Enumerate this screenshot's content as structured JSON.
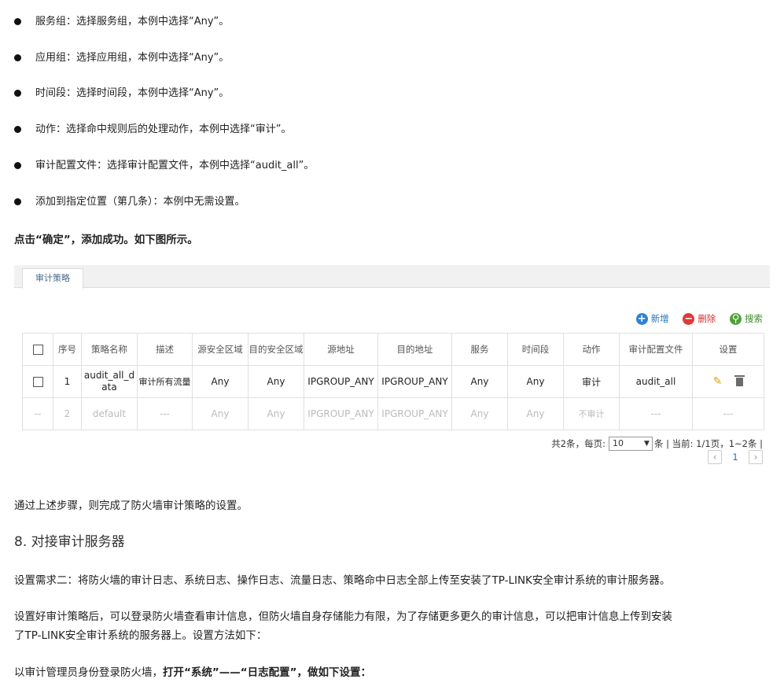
{
  "bullets": [
    "服务组：选择服务组，本例中选择“Any”。",
    "应用组：选择应用组，本例中选择“Any”。",
    "时间段：选择时间段，本例中选择“Any”。",
    "动作：选择命中规则后的处理动作，本例中选择“审计”。",
    "审计配置文件：选择审计配置文件，本例中选择“audit_all”。",
    "添加到指定位置（第几条）：本例中无需设置。"
  ],
  "confirm_text": "点击“确定”，添加成功。如下图所示。",
  "tab_label": "审计策略",
  "toolbar": {
    "add": "新增",
    "delete": "删除",
    "search": "搜索"
  },
  "table": {
    "headers": [
      "序号",
      "策略名称",
      "描述",
      "源安全区域",
      "目的安全区域",
      "源地址",
      "目的地址",
      "服务",
      "时间段",
      "动作",
      "审计配置文件",
      "设置"
    ],
    "rows": [
      {
        "check": "",
        "no": "1",
        "name": "audit_all_data",
        "desc": "审计所有流量",
        "src_zone": "Any",
        "dst_zone": "Any",
        "src_addr": "IPGROUP_ANY",
        "dst_addr": "IPGROUP_ANY",
        "service": "Any",
        "time": "Any",
        "action": "审计",
        "profile": "audit_all",
        "settings": ""
      },
      {
        "check": "--",
        "no": "2",
        "name": "default",
        "desc": "---",
        "src_zone": "Any",
        "dst_zone": "Any",
        "src_addr": "IPGROUP_ANY",
        "dst_addr": "IPGROUP_ANY",
        "service": "Any",
        "time": "Any",
        "action": "不审计",
        "profile": "---",
        "settings": "---"
      }
    ]
  },
  "pager": {
    "total": "共2条，每页:",
    "per_page": "10",
    "suffix": "条 | 当前: 1/1页，1~2条 |",
    "prev": "‹",
    "page": "1",
    "next": "›"
  },
  "summary": "通过上述步骤，则完成了防火墙审计策略的设置。",
  "section_title": "8. 对接审计服务器",
  "req2": "设置需求二：将防火墙的审计日志、系统日志、操作日志、流量日志、策略命中日志全部上传至安装了TP-LINK安全审计系统的审计服务器。",
  "desc_line1": "设置好审计策略后，可以登录防火墙查看审计信息，但防火墙自身存储能力有限，为了存储更多更久的审计信息，可以把审计信息上传到安装",
  "desc_line2": "了TP-LINK安全审计系统的服务器上。设置方法如下：",
  "login_normal": "以审计管理员身份登录防火墙，",
  "login_bold": "打开“系统”——“日志配置”，做如下设置："
}
